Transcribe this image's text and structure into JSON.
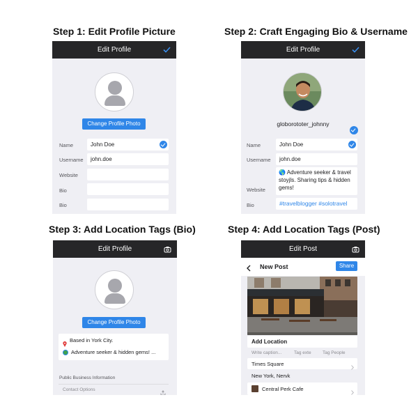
{
  "steps": [
    {
      "title": "Step 1: Edit Profile Picture"
    },
    {
      "title": "Step 2: Craft Engaging Bio & Username"
    },
    {
      "title": "Step 3: Add Location Tags (Bio)"
    },
    {
      "title": "Step 4: Add Location Tags (Post)"
    }
  ],
  "p1": {
    "header": "Edit Profile",
    "change_photo": "Change Profile Photo",
    "rows": [
      {
        "label": "Name",
        "value": "John Doe"
      },
      {
        "label": "Username",
        "value": "john.doe"
      },
      {
        "label": "Website",
        "value": ""
      },
      {
        "label": "Bio",
        "value": ""
      },
      {
        "label": "Bio",
        "value": ""
      }
    ]
  },
  "p2": {
    "header": "Edit Profile",
    "username": "globorototer_johnny",
    "rows": [
      {
        "label": "Name",
        "value": "John Doe"
      },
      {
        "label": "Username",
        "value": "john.doe"
      },
      {
        "label": "Website",
        "value": ""
      },
      {
        "label": "Bio",
        "value": "#travelblogger #solotravel"
      }
    ],
    "bio_text": "🌎 Adventure seeker & travel stoyjls. Sharing tips & hidden gems!"
  },
  "p3": {
    "header": "Edit Profile",
    "change_photo": "Change Profile Photo",
    "location_line": "Based in York City.",
    "bio_line": "Adventure seeker & hidden gems! ...",
    "section_label": "Public Business Information",
    "contact_options": "Contact Options"
  },
  "p4": {
    "header": "Edit Post",
    "new_post": "New Post",
    "share": "Share",
    "add_location": "Add Location",
    "tabs": {
      "caption": "Write caption...",
      "tag1": "Tag exte",
      "tag2": "Tag People"
    },
    "locations": [
      {
        "name": "Times Square"
      },
      {
        "name": "New York, Nervk"
      },
      {
        "name": "Central Perk Cafe"
      }
    ]
  }
}
